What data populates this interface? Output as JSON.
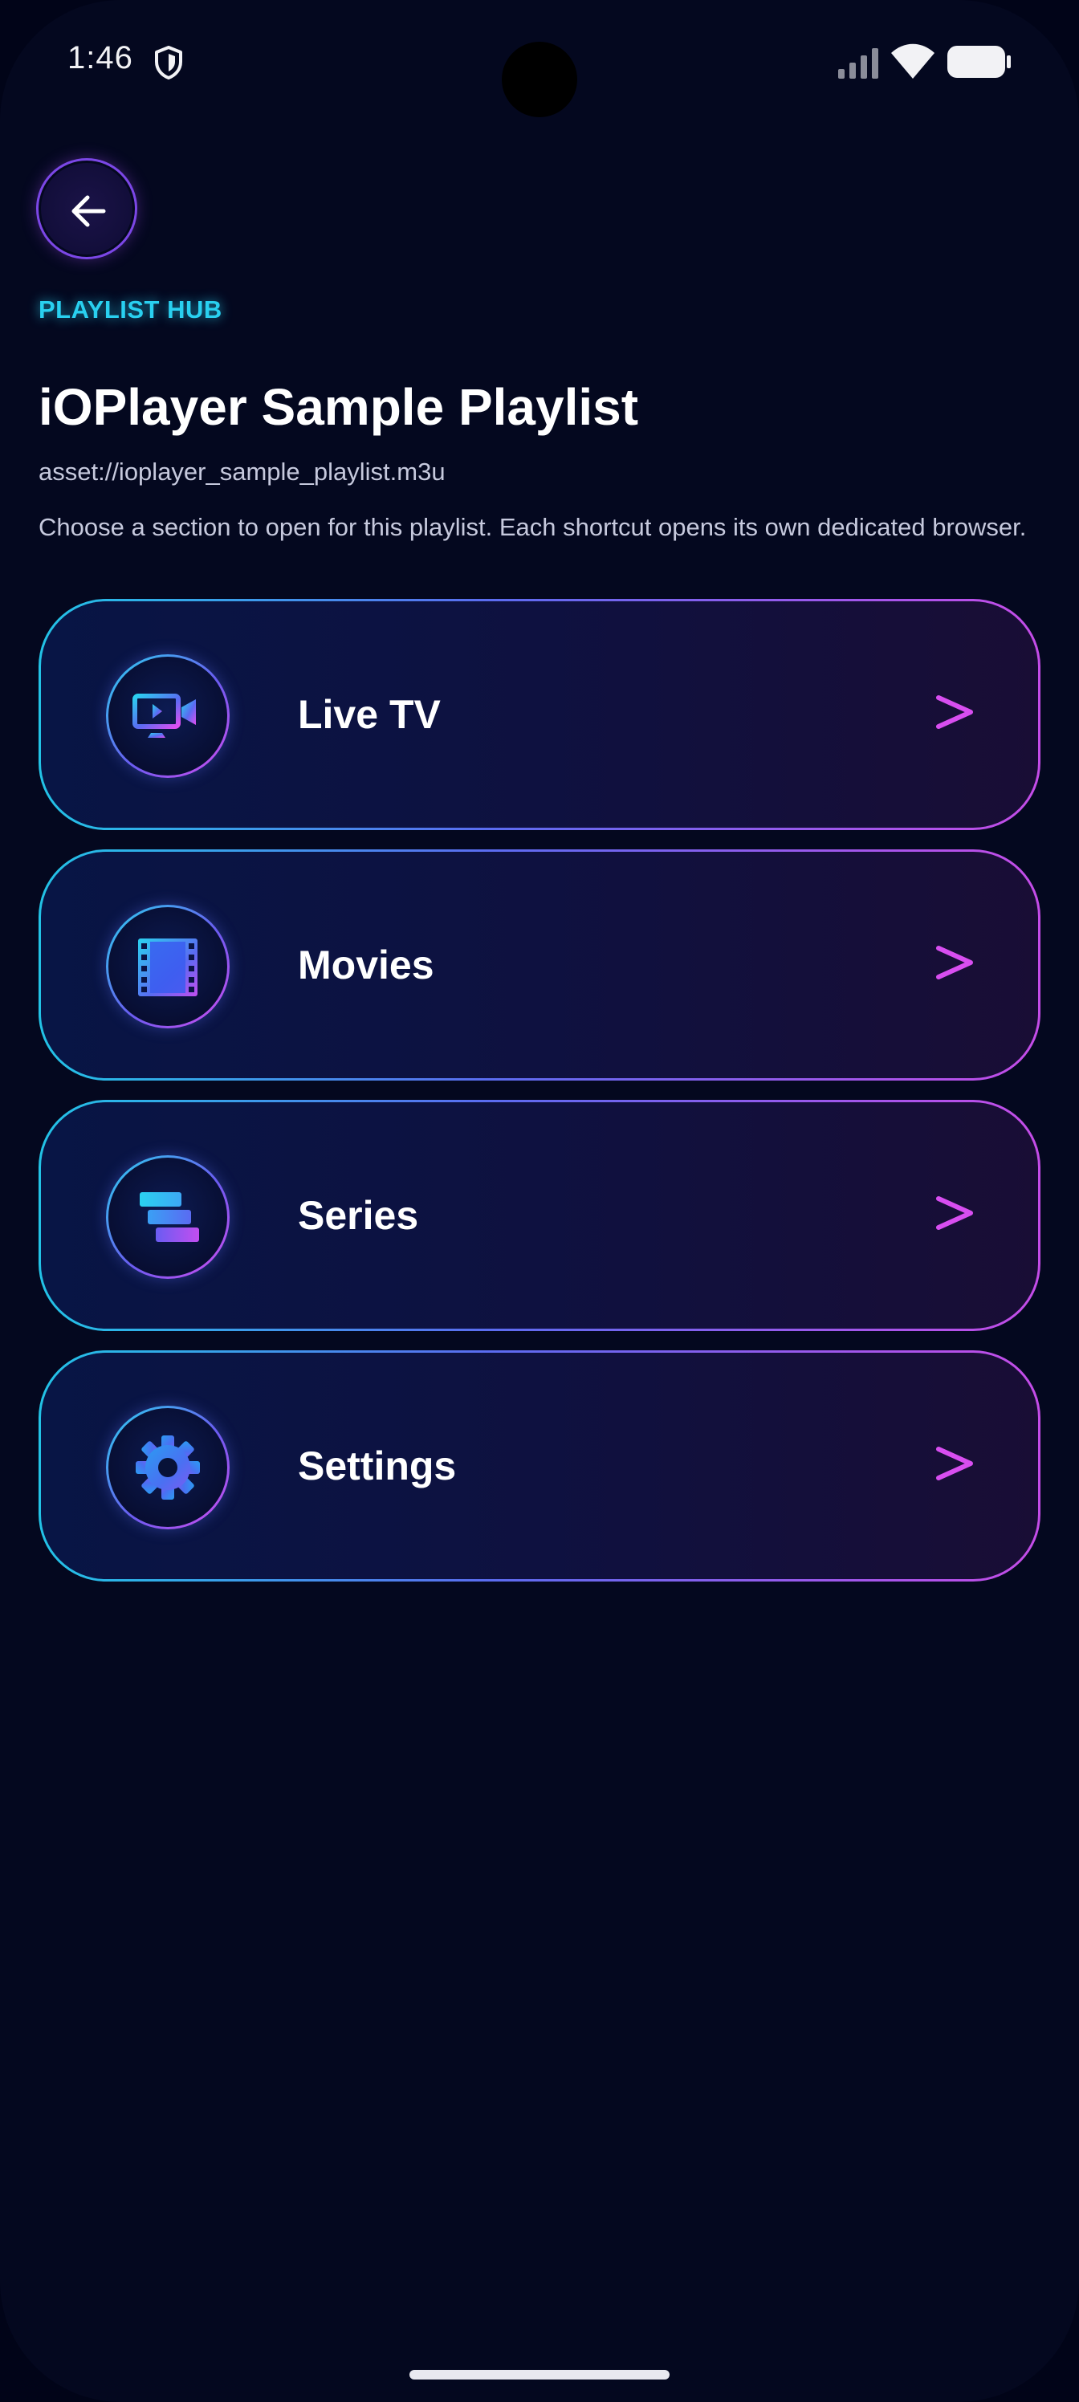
{
  "status_bar": {
    "time": "1:46",
    "icons": [
      "shield-icon",
      "cell-signal-icon",
      "wifi-icon",
      "battery-icon"
    ]
  },
  "header": {
    "back_icon": "arrow-left-icon",
    "overline": "PLAYLIST HUB",
    "title": "iOPlayer Sample Playlist",
    "source": "asset://ioplayer_sample_playlist.m3u",
    "description": "Choose a section to open for this playlist. Each shortcut opens its own dedicated browser."
  },
  "sections": [
    {
      "label": "Live TV",
      "icon": "live-tv-icon"
    },
    {
      "label": "Movies",
      "icon": "film-icon"
    },
    {
      "label": "Series",
      "icon": "series-stack-icon"
    },
    {
      "label": "Settings",
      "icon": "gear-icon"
    }
  ],
  "chevron_text": ">",
  "colors": {
    "background": "#04081f",
    "accent_cyan": "#29d0f0",
    "accent_magenta": "#d54df0",
    "accent_blue": "#5b6cf0"
  }
}
